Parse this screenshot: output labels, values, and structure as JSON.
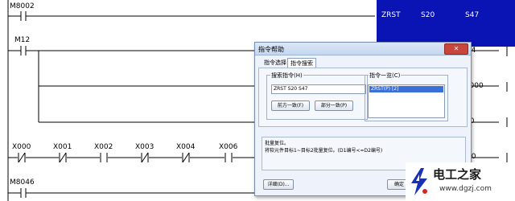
{
  "ladder": {
    "rung1_contact": "M8002",
    "rung2_contact": "M12",
    "rung3_contacts": [
      "X000",
      "X001",
      "X002",
      "X003",
      "X004",
      "X006"
    ],
    "rung4_contact": "M8046",
    "zrst_instruction": "ZRST",
    "zrst_arg1": "S20",
    "zrst_arg2": "S47",
    "coil_m4": "M4",
    "coil_y000": "Y000",
    "coil_s0": "S0",
    "coil_m0": "M0"
  },
  "dialog": {
    "title": "指令帮助",
    "close_glyph": "✕",
    "tabs": [
      "指令选择",
      "指令搜索"
    ],
    "search_group_label": "搜索指令(H)",
    "search_value": "ZRST S20 S47",
    "btn_prefix_match": "前方一致(F)",
    "btn_partial_match": "部分一致(P)",
    "list_group_label": "指令一览(C)",
    "list_items": [
      "ZRST(P) [2]"
    ],
    "description_line1": "批量复位。",
    "description_line2": "将软元件目标1~目标2批量复位。(D1编号<=D2编号)",
    "btn_detail": "详细(D)...",
    "btn_ok": "确定"
  },
  "watermark": {
    "name": "电工之家",
    "url": "www.dgzj.com"
  },
  "colors": {
    "selection_bar": "#0a14b4",
    "list_highlight": "#3a6fd8"
  }
}
